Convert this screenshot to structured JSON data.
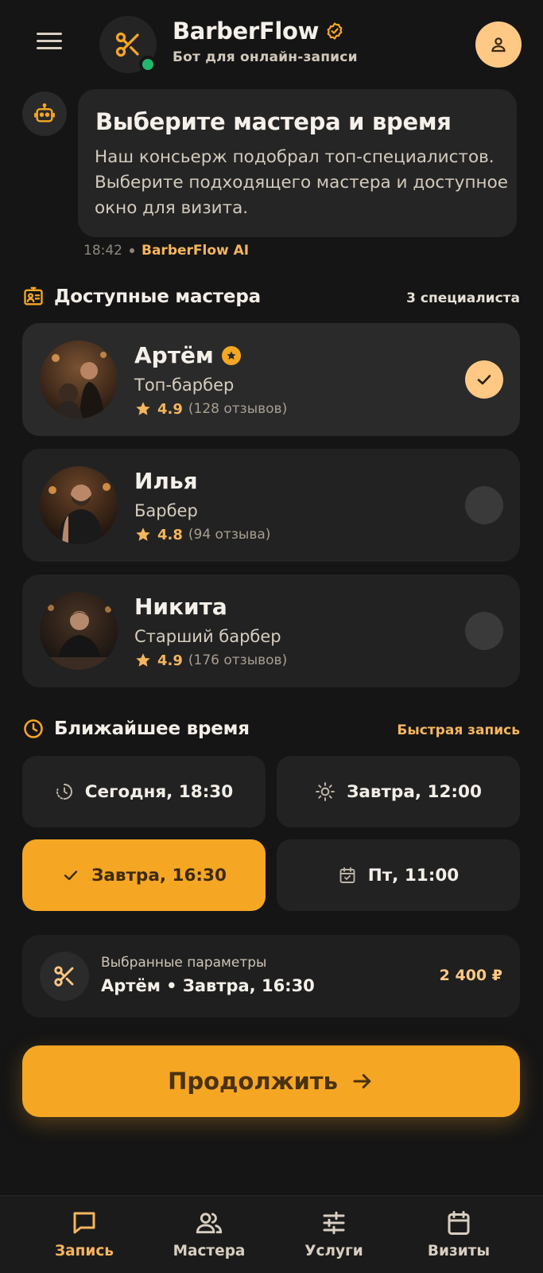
{
  "header": {
    "app_name": "BarberFlow",
    "subtitle": "Бот для онлайн-записи"
  },
  "bot_message": {
    "title": "Выберите мастера и время",
    "text": "Наш консьерж подобрал топ-специалистов. Выберите подходящего мастера и доступное окно для визита.",
    "time": "18:42",
    "sender": "BarberFlow AI"
  },
  "masters_section": {
    "title": "Доступные мастера",
    "count": "3 специалиста",
    "masters": [
      {
        "name": "Артём",
        "role": "Топ-барбер",
        "rating": "4.9",
        "reviews": "(128 отзывов)",
        "top": true,
        "selected": true
      },
      {
        "name": "Илья",
        "role": "Барбер",
        "rating": "4.8",
        "reviews": "(94 отзыва)",
        "top": false,
        "selected": false
      },
      {
        "name": "Никита",
        "role": "Старший барбер",
        "rating": "4.9",
        "reviews": "(176 отзывов)",
        "top": false,
        "selected": false
      }
    ]
  },
  "time_section": {
    "title": "Ближайшее время",
    "quick_link": "Быстрая запись",
    "slots": [
      {
        "label": "Сегодня, 18:30",
        "icon": "clock-history-icon",
        "selected": false
      },
      {
        "label": "Завтра, 12:00",
        "icon": "sun-icon",
        "selected": false
      },
      {
        "label": "Завтра, 16:30",
        "icon": "check-icon",
        "selected": true
      },
      {
        "label": "Пт, 11:00",
        "icon": "calendar-check-icon",
        "selected": false
      }
    ]
  },
  "summary": {
    "label": "Выбранные параметры",
    "value": "Артём • Завтра, 16:30",
    "price": "2 400 ₽"
  },
  "continue_button": {
    "label": "Продолжить"
  },
  "tabbar": {
    "tabs": [
      {
        "label": "Запись",
        "icon": "chat-icon",
        "active": true
      },
      {
        "label": "Мастера",
        "icon": "users-icon",
        "active": false
      },
      {
        "label": "Услуги",
        "icon": "sliders-icon",
        "active": false
      },
      {
        "label": "Визиты",
        "icon": "calendar-icon",
        "active": false
      }
    ]
  },
  "colors": {
    "background": "#151515",
    "card": "#222222",
    "accent": "#f5a623",
    "accent_light": "#ffc985",
    "online": "#22b76a"
  }
}
